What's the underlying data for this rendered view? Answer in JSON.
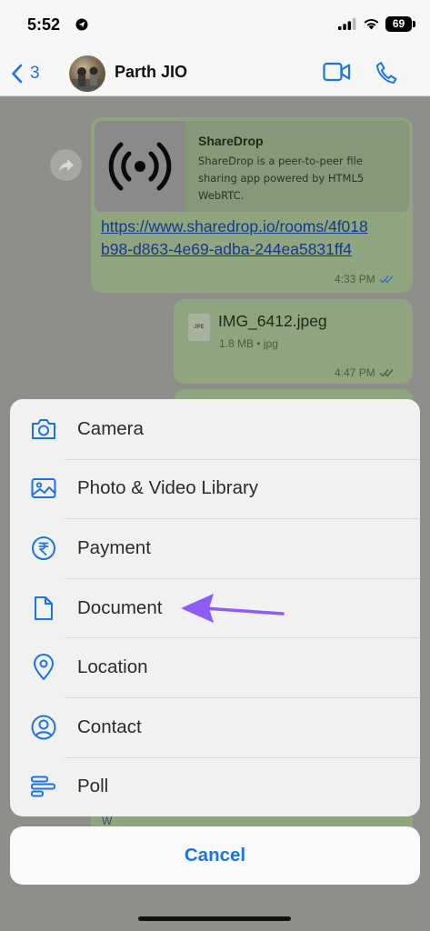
{
  "status": {
    "time": "5:52",
    "battery": "69"
  },
  "nav": {
    "back_count": "3",
    "contact_name": "Parth JIO"
  },
  "messages": {
    "link_preview": {
      "title": "ShareDrop",
      "description": "ShareDrop is a peer-to-peer file sharing app powered by HTML5 WebRTC.",
      "url": "https://www.sharedrop.io/rooms/4f018b98-d863-4e69-adba-244ea5831ff4",
      "time": "4:33 PM"
    },
    "file": {
      "icon_label": "JPE",
      "name": "IMG_6412.jpeg",
      "meta": "1.8 MB • jpg",
      "time": "4:47 PM"
    },
    "bottom_partial": "W"
  },
  "sheet": {
    "items": [
      {
        "label": "Camera",
        "icon": "camera-icon"
      },
      {
        "label": "Photo & Video Library",
        "icon": "photo-library-icon"
      },
      {
        "label": "Payment",
        "icon": "rupee-icon"
      },
      {
        "label": "Document",
        "icon": "document-icon"
      },
      {
        "label": "Location",
        "icon": "location-pin-icon"
      },
      {
        "label": "Contact",
        "icon": "contact-icon"
      },
      {
        "label": "Poll",
        "icon": "poll-icon"
      }
    ],
    "cancel_label": "Cancel"
  },
  "colors": {
    "accent": "#1a73e8",
    "annotation_arrow": "#8b5cf6",
    "sheet_bg": "#f1f1f1"
  }
}
